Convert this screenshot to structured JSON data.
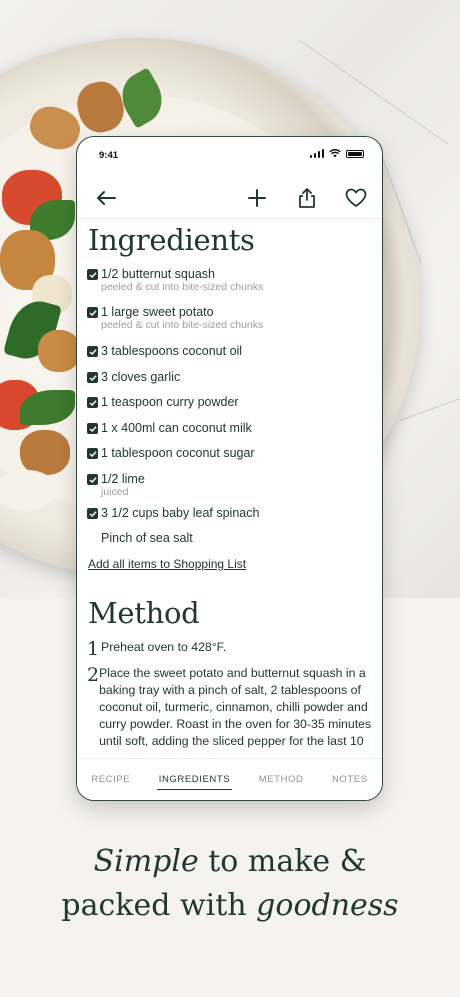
{
  "status": {
    "time": "9:41"
  },
  "ingredients": {
    "title": "Ingredients",
    "items": [
      {
        "name": "1/2 butternut squash",
        "note": "peeled & cut into bite-sized chunks",
        "checked": true
      },
      {
        "name": "1 large sweet potato",
        "note": "peeled & cut into bite-sized chunks",
        "checked": true
      },
      {
        "name": "3 tablespoons coconut oil",
        "checked": true
      },
      {
        "name": "3 cloves garlic",
        "checked": true
      },
      {
        "name": "1 teaspoon curry powder",
        "checked": true
      },
      {
        "name": "1 x 400ml can coconut milk",
        "checked": true
      },
      {
        "name": "1 tablespoon coconut sugar",
        "checked": true
      },
      {
        "name": "1/2 lime",
        "note": "juiced",
        "checked": true
      },
      {
        "name": "3 1/2 cups baby leaf spinach",
        "checked": true
      },
      {
        "name": "Pinch of sea salt",
        "checked": false
      }
    ],
    "add_link": "Add all items to Shopping List"
  },
  "method": {
    "title": "Method",
    "steps": [
      {
        "num": "1",
        "text": "Preheat oven to 428°F."
      },
      {
        "num": "2",
        "text": "Place the sweet potato and butternut squash in a baking tray with a pinch of salt, 2 tablespoons of coconut oil, turmeric, cinnamon, chilli powder and curry powder. Roast in the oven for 30-35 minutes until soft, adding the sliced pepper for the last 10"
      }
    ]
  },
  "tabs": [
    {
      "label": "RECIPE",
      "active": false
    },
    {
      "label": "INGREDIENTS",
      "active": true
    },
    {
      "label": "METHOD",
      "active": false
    },
    {
      "label": "NOTES",
      "active": false
    }
  ],
  "tagline": {
    "line1_italic": "Simple",
    "line1_rest": " to make &",
    "line2_start": "packed with ",
    "line2_italic": "goodness"
  },
  "colors": {
    "accent": "#21392d",
    "muted": "#9aa09c",
    "background": "#f5f3f0"
  },
  "icons": [
    "back-arrow-icon",
    "plus-icon",
    "share-icon",
    "heart-icon",
    "checkbox-checked-icon"
  ]
}
